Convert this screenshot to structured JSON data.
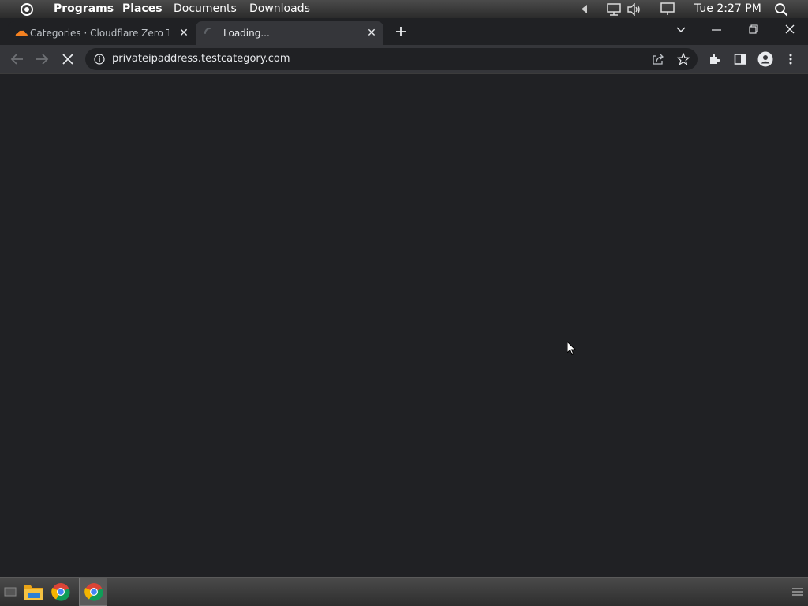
{
  "topbar": {
    "menu": [
      "Programs",
      "Places",
      "Documents",
      "Downloads"
    ],
    "clock": "Tue 2:27 PM"
  },
  "tabs": [
    {
      "title": "Categories · Cloudflare Zero Trust",
      "active": false
    },
    {
      "title": "Loading...",
      "active": true
    }
  ],
  "omnibox": {
    "url": "privateipaddress.testcategory.com"
  },
  "colors": {
    "accent_cloudflare": "#f48120",
    "bg": "#202124",
    "toolbar": "#35363a"
  }
}
